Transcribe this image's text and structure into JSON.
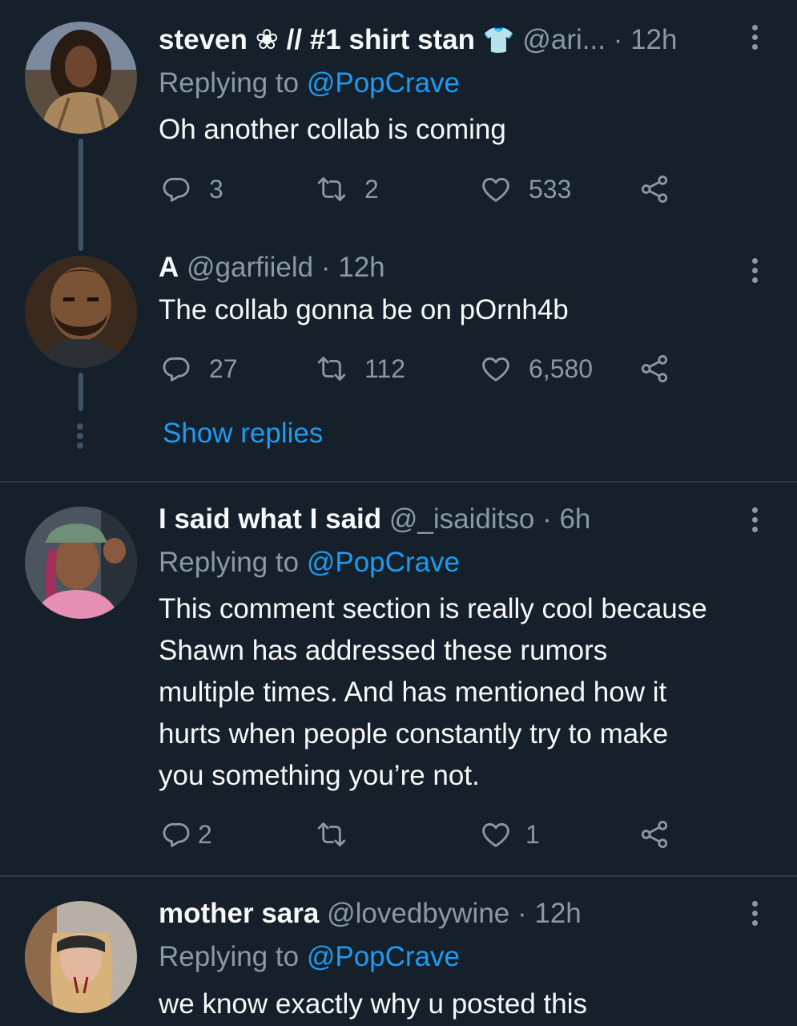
{
  "tweets": [
    {
      "display_name": "steven ❀ // #1 shirt stan",
      "shirt_emoji": "👕",
      "handle": "@ari...",
      "time": "· 12h",
      "replying_prefix": "Replying to",
      "replying_handle": "@PopCrave",
      "text": "Oh another collab is coming",
      "replies": "3",
      "retweets": "2",
      "likes": "533"
    },
    {
      "display_name": "A",
      "handle": "@garfiield",
      "time": "· 12h",
      "text": "The collab gonna be on pOrnh4b",
      "replies": "27",
      "retweets": "112",
      "likes": "6,580",
      "show_replies": "Show replies"
    },
    {
      "display_name": "I said what I said",
      "handle": "@_isaiditso",
      "time": "· 6h",
      "replying_prefix": "Replying to",
      "replying_handle": "@PopCrave",
      "text_lines": [
        "This comment section is really cool because",
        "Shawn has addressed these rumors",
        "multiple times. And has mentioned how it",
        "hurts when people constantly try to make",
        "you something you’re not."
      ],
      "replies": "2",
      "retweets": "",
      "likes": "1"
    },
    {
      "display_name": "mother sara",
      "handle": "@lovedbywine",
      "time": "· 12h",
      "replying_prefix": "Replying to",
      "replying_handle": "@PopCrave",
      "text": "we know exactly why u posted this"
    }
  ],
  "colors": {
    "background": "#15202b",
    "text": "#f7f9f9",
    "muted": "#8b98a5",
    "link": "#1d9bf0",
    "thread_line": "#3d5466"
  },
  "icons": [
    "reply-icon",
    "retweet-icon",
    "like-icon",
    "share-icon",
    "more-icon"
  ]
}
